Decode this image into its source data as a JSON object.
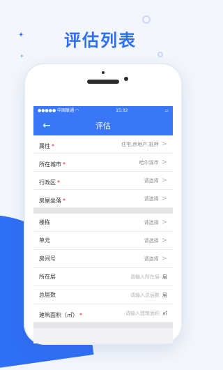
{
  "header": {
    "title": "评估列表"
  },
  "statusbar": {
    "carrier": "●●●●● 中国联通 ◠",
    "time": "15:32",
    "battery": "▭"
  },
  "navbar": {
    "back_icon": "←",
    "title": "评估"
  },
  "form": {
    "group1": [
      {
        "label": "属性",
        "required": true,
        "value": "住宅,房地产,抵押",
        "chevron": ">"
      },
      {
        "label": "所在城市",
        "required": true,
        "value": "哈尔滨市",
        "chevron": ">"
      },
      {
        "label": "行政区",
        "required": true,
        "value": "请选择",
        "chevron": ">"
      },
      {
        "label": "房屋坐落",
        "required": true,
        "value": "请选择",
        "chevron": ">"
      }
    ],
    "group2": [
      {
        "label": "楼栋",
        "value": "请选择",
        "chevron": ">"
      },
      {
        "label": "单元",
        "value": "请选择",
        "chevron": ">"
      },
      {
        "label": "房间号",
        "value": "请选择",
        "chevron": ">"
      },
      {
        "label": "所在层",
        "placeholder": "请输入所在层",
        "unit": "层"
      },
      {
        "label": "总层数",
        "placeholder": "请输入总层数",
        "unit": "层"
      },
      {
        "label": "建筑面积（㎡）",
        "required": true,
        "placeholder": "请输入建筑面积",
        "unit": "㎡"
      }
    ],
    "required_mark": "*"
  },
  "colors": {
    "accent": "#3a77f7",
    "required": "#e0202a"
  }
}
